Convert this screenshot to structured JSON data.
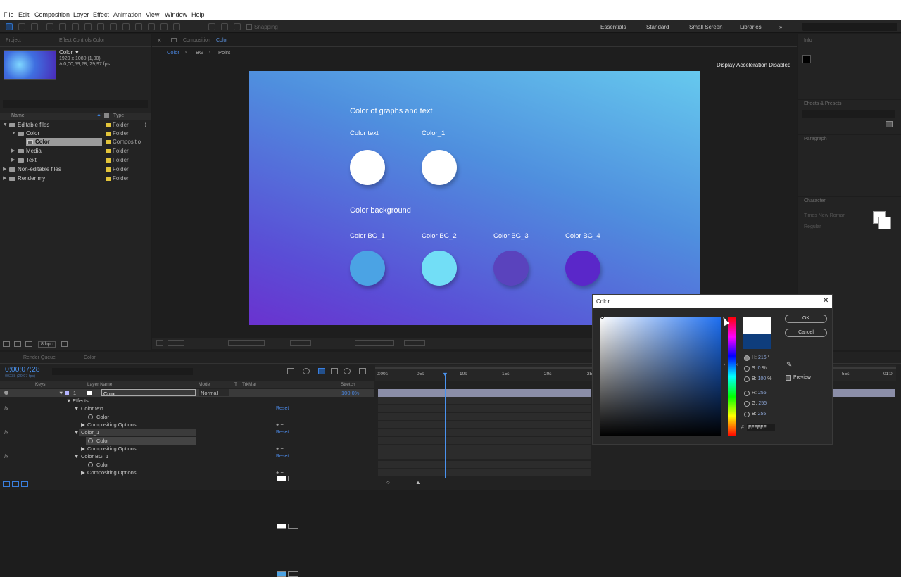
{
  "menu": [
    "File",
    "Edit",
    "Composition",
    "Layer",
    "Effect",
    "Animation",
    "View",
    "Window",
    "Help"
  ],
  "toolbar": {
    "snapping": "Snapping",
    "workspaces": [
      "Essentials",
      "Standard",
      "Small Screen",
      "Libraries"
    ],
    "more": "»"
  },
  "project": {
    "tab": "Project",
    "effect_tab": "Effect Controls Color",
    "item_name": "Color ▼",
    "item_size": "1920 x 1080 (1,00)",
    "item_duration": "Δ 0;00;59;28, 29,97 fps",
    "columns": {
      "name": "Name",
      "type": "Type"
    },
    "rows": [
      {
        "name": "Editable files",
        "type": "Folder",
        "indent": 0,
        "tri": "▼"
      },
      {
        "name": "Color",
        "type": "Folder",
        "indent": 1,
        "tri": "▼"
      },
      {
        "name": "Color",
        "type": "Compositio",
        "indent": 2,
        "tri": ""
      },
      {
        "name": "Media",
        "type": "Folder",
        "indent": 1,
        "tri": "▶"
      },
      {
        "name": "Text",
        "type": "Folder",
        "indent": 1,
        "tri": "▶"
      },
      {
        "name": "Non-editable files",
        "type": "Folder",
        "indent": 0,
        "tri": "▶"
      },
      {
        "name": "Render my",
        "type": "Folder",
        "indent": 0,
        "tri": "▶"
      }
    ],
    "bpc": "8 bpc"
  },
  "composition": {
    "tab": "Composition",
    "tab_name": "Color",
    "breadcrumbs": [
      "Color",
      "BG",
      "Point"
    ],
    "notice": "Display Acceleration Disabled"
  },
  "canvas": {
    "title1": "Color of graphs and text",
    "label_text": "Color text",
    "label_c1": "Color_1",
    "title2": "Color background",
    "bg_labels": [
      "Color BG_1",
      "Color BG_2",
      "Color BG_3",
      "Color BG_4"
    ],
    "colors": {
      "text": "#ffffff",
      "c1": "#ffffff",
      "bg1": "#4ba3e4",
      "bg2": "#72def6",
      "bg3": "#5a43bd",
      "bg4": "#5a27c9"
    }
  },
  "color_dialog": {
    "title": "Color",
    "close": "✕",
    "ok": "OK",
    "cancel": "Cancel",
    "preview": "Preview",
    "new_color": "#ffffff",
    "old_color": "#0e3d7c",
    "hsb": [
      {
        "key": "H:",
        "value": "216",
        "unit": "°"
      },
      {
        "key": "S:",
        "value": "0",
        "unit": "%"
      },
      {
        "key": "B:",
        "value": "100",
        "unit": "%"
      }
    ],
    "rgb": [
      {
        "key": "R:",
        "value": "255"
      },
      {
        "key": "G:",
        "value": "255"
      },
      {
        "key": "B:",
        "value": "255"
      }
    ],
    "hex_prefix": "#",
    "hex": "FFFFFF"
  },
  "timeline": {
    "tabs": [
      "Render Queue",
      "Color"
    ],
    "timecode": "0;00;07;28",
    "timecode_sub": "00238 (29.97 fps)",
    "cols": {
      "keys": "Keys",
      "layer_name": "Layer Name",
      "mode": "Mode",
      "t": "T",
      "trkmat": "TrkMat",
      "stretch": "Stretch"
    },
    "layer": {
      "num": "1",
      "name": "Color",
      "mode": "Normal",
      "stretch": "100,0%"
    },
    "effects": "Effects",
    "groups": [
      {
        "name": "Color text",
        "prop": "Color",
        "opts": "Compositing Options",
        "swatch": "#ffffff"
      },
      {
        "name": "Color_1",
        "prop": "Color",
        "opts": "Compositing Options",
        "swatch": "#ffffff"
      },
      {
        "name": "Color BG_1",
        "prop": "Color",
        "opts": "Compositing Options",
        "swatch": "#4ba3e4"
      }
    ],
    "reset": "Reset",
    "ruler": [
      "0:00s",
      "05s",
      "10s",
      "15s",
      "20s",
      "25"
    ],
    "ruler_right": [
      "55s",
      "01:0"
    ],
    "fx": "fx"
  },
  "right_panels": {
    "info": "Info",
    "effects_presets": "Effects & Presets",
    "paragraph": "Paragraph",
    "character": "Character",
    "font": "Times New Roman",
    "style": "Regular"
  }
}
